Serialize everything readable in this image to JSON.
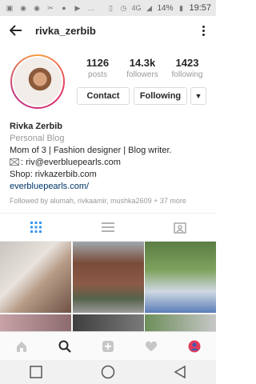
{
  "status_bar": {
    "time": "19:57",
    "battery": "14%",
    "network": "4G",
    "left_icons": [
      "sim-icon",
      "whatsapp-icon",
      "whatsapp-icon",
      "cut-icon",
      "vk-icon",
      "play-icon",
      "more-dots-icon"
    ],
    "right_icons": [
      "vibrate-icon",
      "alarm-icon",
      "network-icon",
      "signal-icon",
      "battery-icon"
    ]
  },
  "topbar": {
    "username": "rivka_zerbib"
  },
  "profile": {
    "stats": [
      {
        "value": "1126",
        "label": "posts"
      },
      {
        "value": "14.3k",
        "label": "followers"
      },
      {
        "value": "1423",
        "label": "following"
      }
    ],
    "buttons": {
      "contact": "Contact",
      "following": "Following",
      "dropdown": "▼"
    }
  },
  "bio": {
    "name": "Rivka Zerbib",
    "category": "Personal Blog",
    "line1": "Mom of 3 | Fashion designer | Blog writer.",
    "email_line": ": riv@everbluepearls.com",
    "shop_line": "Shop: rivkazerbib.com",
    "link": "everbluepearls.com/",
    "followed_by": "Followed by alumah, rivkaamir, mushka2609 + 37 more"
  },
  "tabs": [
    "grid-icon",
    "list-icon",
    "tagged-icon"
  ],
  "bottom_nav": [
    "home-icon",
    "search-icon",
    "add-icon",
    "heart-icon",
    "profile-icon"
  ],
  "colors": {
    "link": "#003569",
    "muted": "#999999",
    "accent_grid": "#3897f0"
  }
}
